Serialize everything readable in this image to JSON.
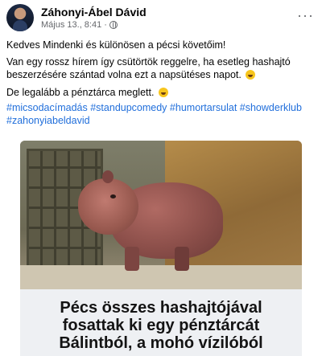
{
  "post": {
    "author": "Záhonyi-Ábel Dávid",
    "timestamp": "Május 13., 8:41",
    "separator": "·",
    "more_glyph": "···",
    "paragraphs": [
      "Kedves Mindenki és különösen a pécsi követőim!",
      "Van egy rossz hírem így csütörtök reggelre, ha esetleg hashajtó beszerzésére szántad volna ezt a napsütéses napot.",
      "De legalább a pénztárca meglett."
    ],
    "hashtags": [
      "#micsodacímadás",
      "#standupcomedy",
      "#humortarsulat",
      "#showderklub",
      "#zahonyiabeldavid"
    ]
  },
  "link_preview": {
    "headline_lines": [
      "Pécs összes hashajtójával",
      "fosattak ki egy pénztárcát",
      "Bálintból, a mohó vízilóból"
    ]
  },
  "icons": {
    "privacy": "globe-icon",
    "menu": "more-options-icon",
    "emoji": "laughing-emoji-icon"
  }
}
